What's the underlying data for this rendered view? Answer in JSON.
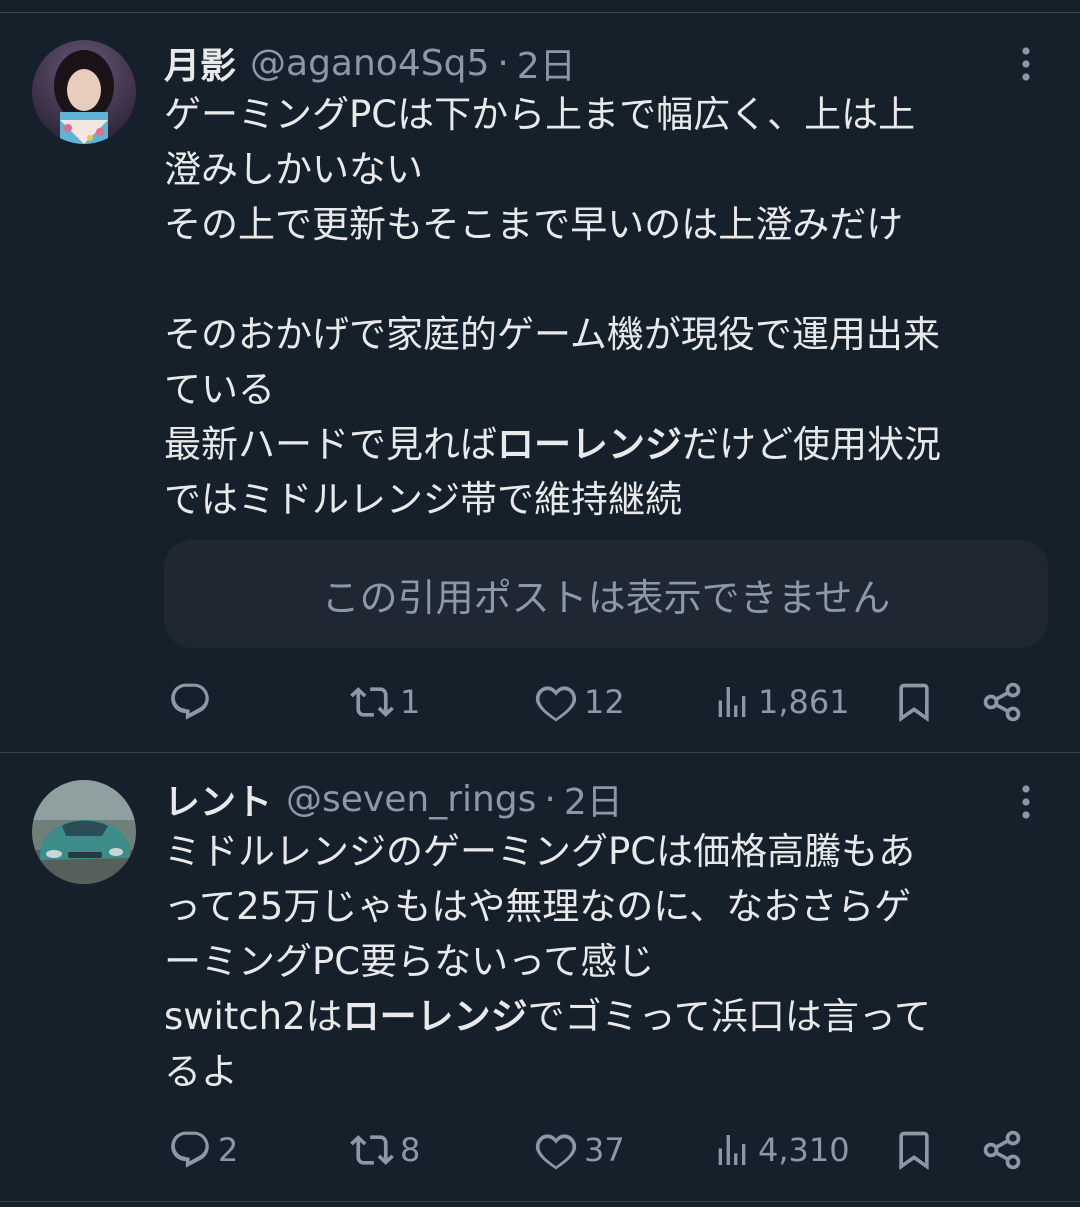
{
  "tweets": [
    {
      "display_name": "月影",
      "handle": "@agano4Sq5",
      "separator": "·",
      "time": "2日",
      "avatar_icon": "user-avatar-kimono-photo",
      "text_lines": [
        [
          {
            "t": "ゲーミングPCは下から上まで幅広く、上は上"
          }
        ],
        [
          {
            "t": "澄みしかいない"
          }
        ],
        [
          {
            "t": "その上で更新もそこまで早いのは上澄みだけ"
          }
        ],
        [
          {
            "t": ""
          }
        ],
        [
          {
            "t": "そのおかげで家庭的ゲーム機が現役で運用出来"
          }
        ],
        [
          {
            "t": "ている"
          }
        ],
        [
          {
            "t": "最新ハードで見れば"
          },
          {
            "t": "ローレンジ",
            "b": true
          },
          {
            "t": "だけど使用状況"
          }
        ],
        [
          {
            "t": "ではミドルレンジ帯で維持継続"
          }
        ]
      ],
      "quote_unavailable": "この引用ポストは表示できません",
      "replies": "",
      "reposts": "1",
      "likes": "12",
      "views": "1,861"
    },
    {
      "display_name": "レント",
      "handle": "@seven_rings",
      "separator": "·",
      "time": "2日",
      "avatar_icon": "user-avatar-car-photo",
      "text_lines": [
        [
          {
            "t": "ミドルレンジのゲーミングPCは価格高騰もあ"
          }
        ],
        [
          {
            "t": "って25万じゃもはや無理なのに、なおさらゲ"
          }
        ],
        [
          {
            "t": "ーミングPC要らないって感じ"
          }
        ],
        [
          {
            "t": "switch2は"
          },
          {
            "t": "ローレンジ",
            "b": true
          },
          {
            "t": "でゴミって浜口は言って"
          }
        ],
        [
          {
            "t": "るよ"
          }
        ]
      ],
      "replies": "2",
      "reposts": "8",
      "likes": "37",
      "views": "4,310"
    }
  ],
  "icons": {
    "reply": "reply-icon",
    "repost": "repost-icon",
    "like": "heart-icon",
    "views": "views-icon",
    "bookmark": "bookmark-icon",
    "share": "share-icon",
    "more": "more-vertical-icon"
  },
  "colors": {
    "background": "#15202b",
    "text": "#e7e9ea",
    "muted": "#8b98a5",
    "divider": "#38444d",
    "quote_box": "#1e2732"
  }
}
